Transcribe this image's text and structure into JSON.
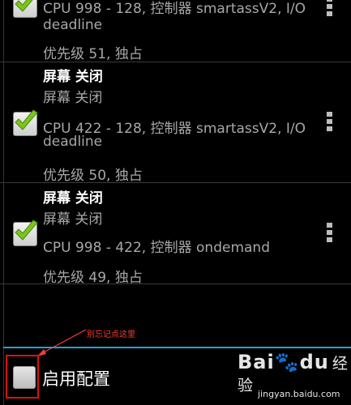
{
  "rules": [
    {
      "title": "",
      "lines": [
        "CPU 998 - 128, 控制器 smartassV2, I/O",
        "deadline",
        "优先级 51, 独占"
      ],
      "checked": true
    },
    {
      "title": "屏幕 关闭",
      "lines": [
        "屏幕 关闭",
        "CPU 422 - 128, 控制器 smartassV2, I/O",
        "deadline",
        "优先级 50, 独占"
      ],
      "checked": true
    },
    {
      "title": "屏幕 关闭",
      "lines": [
        "屏幕 关闭",
        "CPU 998 - 422, 控制器 ondemand",
        "优先级 49, 独占"
      ],
      "checked": true
    }
  ],
  "bottom": {
    "enable_label": "启用配置",
    "enabled": false
  },
  "annotation": {
    "text": "别忘记点这里"
  },
  "watermark": {
    "logo_left": "Bai",
    "logo_right": "du",
    "logo_cn": "经验",
    "url": "jingyan.baidu.com"
  },
  "colors": {
    "accent_divider": "#1fa3d6",
    "check_green": "#7ac41c",
    "annotation_red": "#ff3a3a"
  }
}
